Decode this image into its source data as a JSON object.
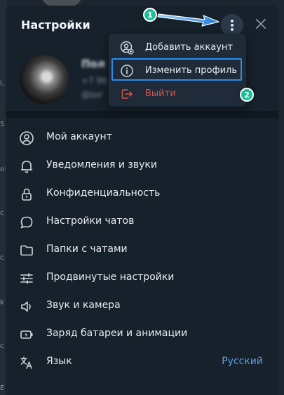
{
  "dialog": {
    "title": "Настройки"
  },
  "profile": {
    "name": "Пол",
    "phone": "+7 96",
    "username": "@sor"
  },
  "popup": {
    "items": [
      {
        "label": "Добавить аккаунт",
        "icon": "add-account-icon"
      },
      {
        "label": "Изменить профиль",
        "icon": "info-icon"
      },
      {
        "label": "Выйти",
        "icon": "logout-icon"
      }
    ]
  },
  "settings": {
    "items": [
      {
        "label": "Мой аккаунт",
        "icon": "account-icon"
      },
      {
        "label": "Уведомления и звуки",
        "icon": "bell-icon"
      },
      {
        "label": "Конфиденциальность",
        "icon": "lock-icon"
      },
      {
        "label": "Настройки чатов",
        "icon": "chat-icon"
      },
      {
        "label": "Папки с чатами",
        "icon": "folder-icon"
      },
      {
        "label": "Продвинутые настройки",
        "icon": "sliders-icon"
      },
      {
        "label": "Звук и камера",
        "icon": "speaker-icon"
      },
      {
        "label": "Заряд батареи и анимации",
        "icon": "battery-icon"
      },
      {
        "label": "Язык",
        "icon": "translate-icon",
        "value": "Русский"
      }
    ]
  },
  "annotations": {
    "step1": "1",
    "step2": "2"
  },
  "colors": {
    "accent": "#5aa0e6",
    "danger": "#e0524a",
    "highlight": "#2a8ee8",
    "badge": "#1bbf9c"
  }
}
